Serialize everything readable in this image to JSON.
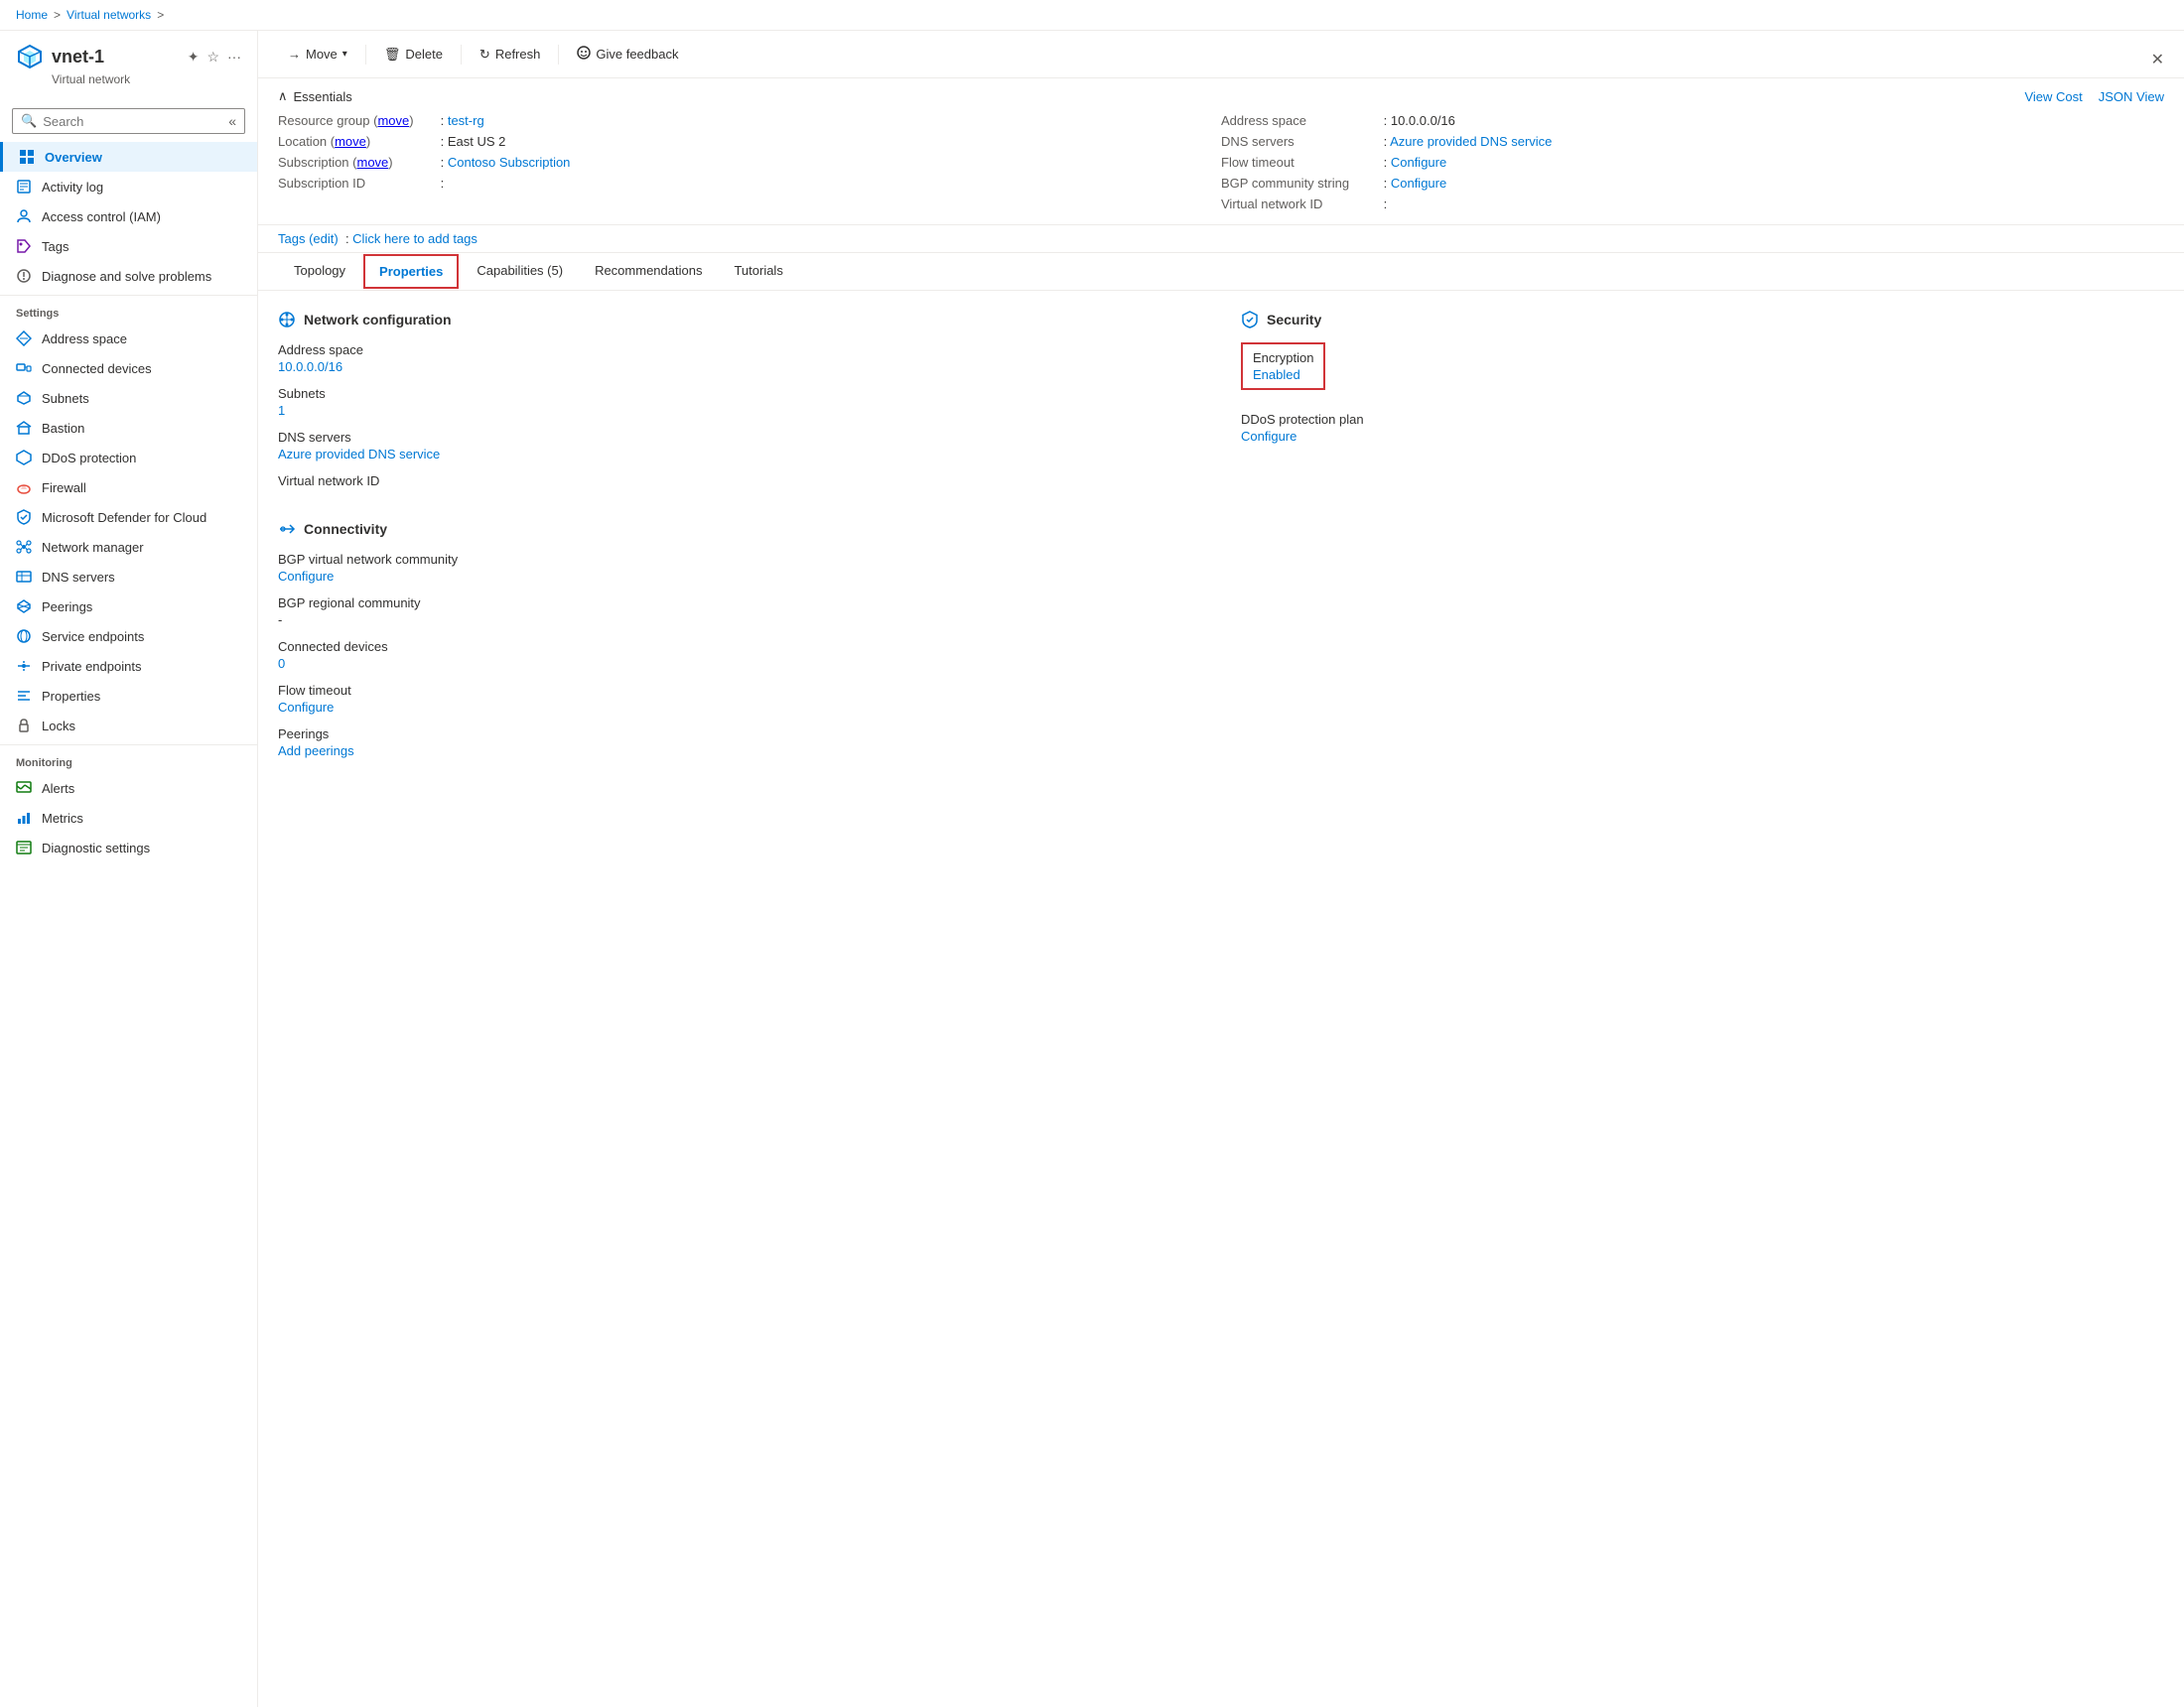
{
  "breadcrumb": {
    "home": "Home",
    "separator1": ">",
    "virtual_networks": "Virtual networks",
    "separator2": ">"
  },
  "header": {
    "resource_name": "vnet-1",
    "resource_type": "Virtual network",
    "close_label": "✕"
  },
  "toolbar": {
    "move_label": "Move",
    "delete_label": "Delete",
    "refresh_label": "Refresh",
    "feedback_label": "Give feedback"
  },
  "essentials": {
    "title": "Essentials",
    "view_cost": "View Cost",
    "json_view": "JSON View",
    "fields_left": [
      {
        "label": "Resource group (move)",
        "value": "test-rg",
        "link": true
      },
      {
        "label": "Location (move)",
        "value": "East US 2",
        "link": false
      },
      {
        "label": "Subscription (move)",
        "value": "Contoso Subscription",
        "link": true
      },
      {
        "label": "Subscription ID",
        "value": "",
        "link": false
      }
    ],
    "fields_right": [
      {
        "label": "Address space",
        "value": "10.0.0.0/16",
        "link": false
      },
      {
        "label": "DNS servers",
        "value": "Azure provided DNS service",
        "link": true
      },
      {
        "label": "Flow timeout",
        "value": "Configure",
        "link": true
      },
      {
        "label": "BGP community string",
        "value": "Configure",
        "link": true
      },
      {
        "label": "Virtual network ID",
        "value": "",
        "link": false
      }
    ]
  },
  "tags": {
    "label": "Tags (edit)",
    "value": "Click here to add tags"
  },
  "tabs": [
    {
      "label": "Topology",
      "active": false
    },
    {
      "label": "Properties",
      "active": true
    },
    {
      "label": "Capabilities (5)",
      "active": false
    },
    {
      "label": "Recommendations",
      "active": false
    },
    {
      "label": "Tutorials",
      "active": false
    }
  ],
  "network_config": {
    "heading": "Network configuration",
    "address_space_label": "Address space",
    "address_space_value": "10.0.0.0/16",
    "subnets_label": "Subnets",
    "subnets_value": "1",
    "dns_servers_label": "DNS servers",
    "dns_servers_value": "Azure provided DNS service",
    "vnet_id_label": "Virtual network ID"
  },
  "security": {
    "heading": "Security",
    "encryption_label": "Encryption",
    "encryption_value": "Enabled",
    "ddos_label": "DDoS protection plan",
    "ddos_value": "Configure"
  },
  "connectivity": {
    "heading": "Connectivity",
    "bgp_community_label": "BGP virtual network community",
    "bgp_community_value": "Configure",
    "bgp_regional_label": "BGP regional community",
    "bgp_regional_value": "-",
    "connected_devices_label": "Connected devices",
    "connected_devices_value": "0",
    "flow_timeout_label": "Flow timeout",
    "flow_timeout_value": "Configure",
    "peerings_label": "Peerings",
    "peerings_value": "Add peerings"
  },
  "sidebar": {
    "search_placeholder": "Search",
    "items_main": [
      {
        "label": "Overview",
        "active": true,
        "icon": "overview"
      },
      {
        "label": "Activity log",
        "active": false,
        "icon": "activity"
      },
      {
        "label": "Access control (IAM)",
        "active": false,
        "icon": "iam"
      },
      {
        "label": "Tags",
        "active": false,
        "icon": "tags"
      },
      {
        "label": "Diagnose and solve problems",
        "active": false,
        "icon": "diagnose"
      }
    ],
    "settings_label": "Settings",
    "settings_items": [
      {
        "label": "Address space",
        "active": false,
        "icon": "address"
      },
      {
        "label": "Connected devices",
        "active": false,
        "icon": "devices"
      },
      {
        "label": "Subnets",
        "active": false,
        "icon": "subnets"
      },
      {
        "label": "Bastion",
        "active": false,
        "icon": "bastion"
      },
      {
        "label": "DDoS protection",
        "active": false,
        "icon": "ddos"
      },
      {
        "label": "Firewall",
        "active": false,
        "icon": "firewall"
      },
      {
        "label": "Microsoft Defender for Cloud",
        "active": false,
        "icon": "defender"
      },
      {
        "label": "Network manager",
        "active": false,
        "icon": "network-mgr"
      },
      {
        "label": "DNS servers",
        "active": false,
        "icon": "dns"
      },
      {
        "label": "Peerings",
        "active": false,
        "icon": "peerings"
      },
      {
        "label": "Service endpoints",
        "active": false,
        "icon": "endpoints"
      },
      {
        "label": "Private endpoints",
        "active": false,
        "icon": "private"
      },
      {
        "label": "Properties",
        "active": false,
        "icon": "properties"
      },
      {
        "label": "Locks",
        "active": false,
        "icon": "locks"
      }
    ],
    "monitoring_label": "Monitoring",
    "monitoring_items": [
      {
        "label": "Alerts",
        "active": false,
        "icon": "alerts"
      },
      {
        "label": "Metrics",
        "active": false,
        "icon": "metrics"
      },
      {
        "label": "Diagnostic settings",
        "active": false,
        "icon": "diag-settings"
      }
    ]
  }
}
